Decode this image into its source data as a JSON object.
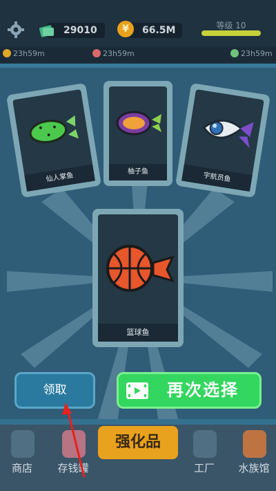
{
  "header": {
    "cash": "29010",
    "coins": "66.5M",
    "coin_symbol": "¥",
    "level": "等级 10"
  },
  "timers": [
    "23h59m",
    "23h59m",
    "23h59m"
  ],
  "cards": [
    {
      "name": "仙人掌鱼"
    },
    {
      "name": "柚子鱼"
    },
    {
      "name": "宇航员鱼"
    },
    {
      "name": "篮球鱼"
    }
  ],
  "buttons": {
    "claim": "领取",
    "choose_again": "再次选择"
  },
  "nav": {
    "shop": "商店",
    "piggy": "存钱罐",
    "center": "强化品",
    "factory": "工厂",
    "aquarium": "水族馆"
  },
  "colors": {
    "panel": "#2f5c77",
    "claim_button": "#2a7aa0",
    "choose_button": "#33d65e",
    "center_tab": "#e9a21d"
  }
}
